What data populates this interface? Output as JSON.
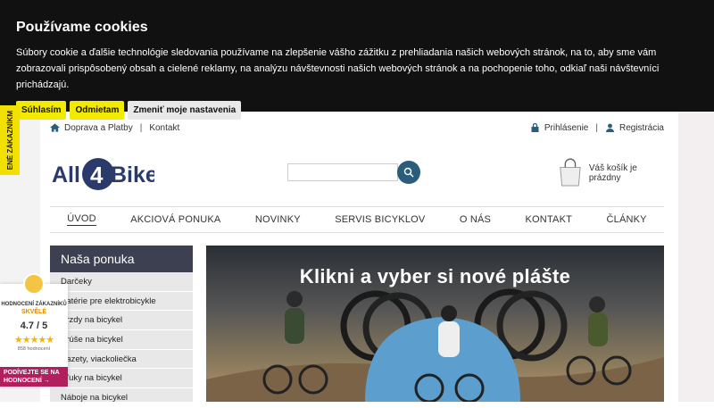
{
  "cookie": {
    "title": "Používame cookies",
    "text": "Súbory cookie a ďalšie technológie sledovania používame na zlepšenie vášho zážitku z prehliadania našich webových stránok, na to, aby sme vám zobrazovali prispôsobený obsah a cielené reklamy, na analýzu návštevnosti našich webových stránok a na pochopenie toho, odkiaľ naši návštevníci prichádzajú.",
    "accept": "Súhlasím",
    "reject": "Odmietam",
    "settings": "Zmeniť moje nastavenia"
  },
  "side_tab": "ENÉ ZÁKAZNÍKM",
  "topbar": {
    "shipping": "Doprava a Platby",
    "contact": "Kontakt",
    "login": "Prihlásenie",
    "register": "Registrácia"
  },
  "logo": {
    "part1": "All",
    "num": "4",
    "part2": "Bike"
  },
  "search": {
    "placeholder": ""
  },
  "cart": {
    "text": "Váš košík je prázdny"
  },
  "nav": [
    "ÚVOD",
    "AKCIOVÁ PONUKA",
    "NOVINKY",
    "SERVIS BICYKLOV",
    "O NÁS",
    "KONTAKT",
    "ČLÁNKY"
  ],
  "sidebar": {
    "title": "Naša ponuka",
    "items": [
      "Darčeky",
      "Batérie pre elektrobicykle",
      "Brzdy na bicykel",
      "Brúše na bicykel",
      "Kazety, viackoliečka",
      "Kľuky na bicykel",
      "Náboje na bicykel"
    ]
  },
  "banner": {
    "title": "Klikni a vyber si nové plášte"
  },
  "rating": {
    "label": "HODNOCENÍ ZÁKAZNÍKŮ",
    "quality": "SKVĚLÉ",
    "score": "4.7 / 5",
    "stars": "★★★★★",
    "count": "858 hodnocení",
    "cta": "PODÍVEJTE SE NA HODNOCENÍ →"
  },
  "colors": {
    "accent": "#f2ea00",
    "nav_dark": "#3c4050",
    "search_btn": "#2a5d7b",
    "cta": "#b21f5f"
  }
}
